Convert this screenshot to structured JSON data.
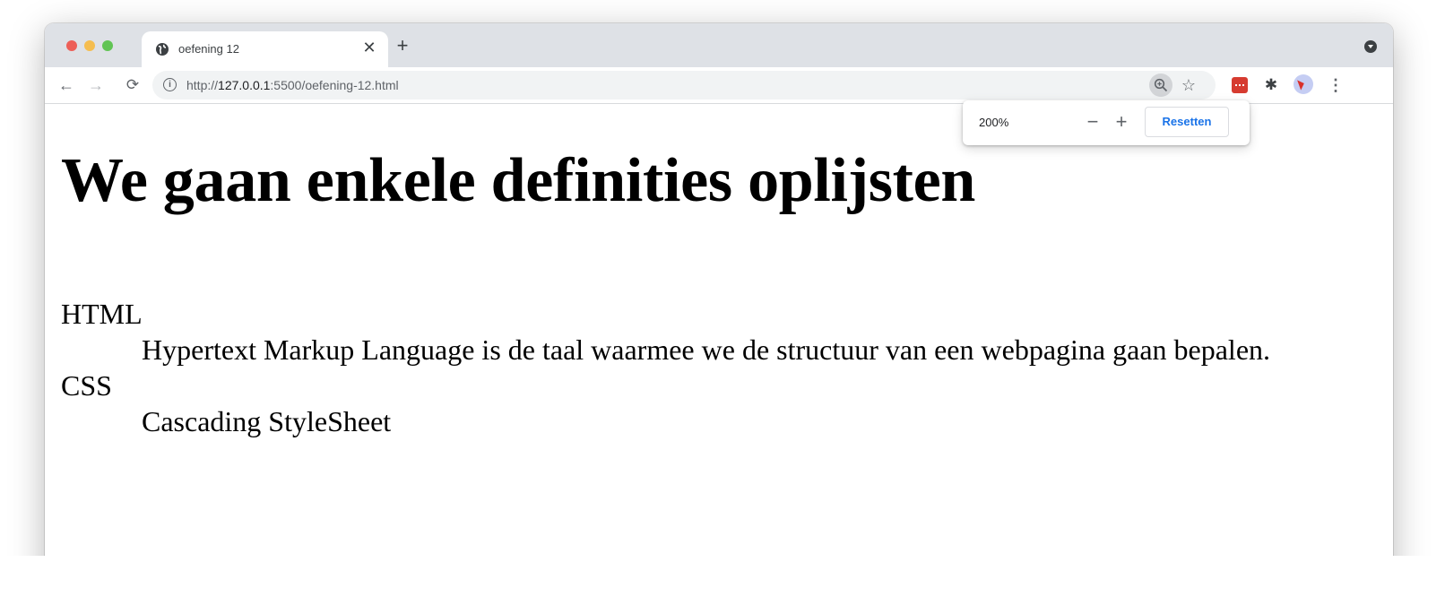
{
  "browser": {
    "tab": {
      "title": "oefening 12"
    },
    "url": {
      "scheme": "http://",
      "host": "127.0.0.1",
      "rest": ":5500/oefening-12.html"
    }
  },
  "zoom_popup": {
    "level": "200%",
    "minus": "−",
    "plus": "+",
    "reset_label": "Resetten"
  },
  "page": {
    "title": "We gaan enkele definities oplijsten",
    "definitions": [
      {
        "term": "HTML",
        "description": "Hypertext Markup Language is de taal waarmee we de structuur van een webpagina gaan bepalen."
      },
      {
        "term": "CSS",
        "description": "Cascading StyleSheet"
      }
    ]
  }
}
